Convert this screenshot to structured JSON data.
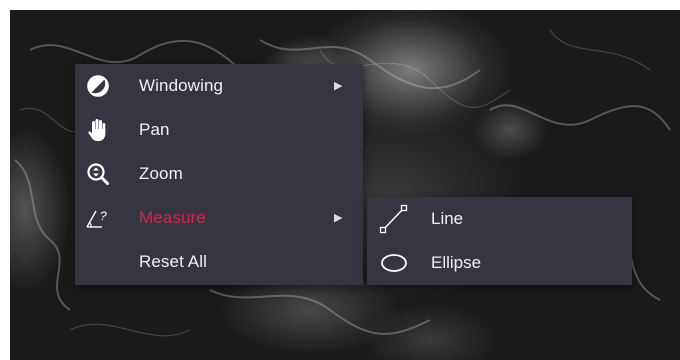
{
  "menu": {
    "items": [
      {
        "label": "Windowing",
        "icon": "contrast-icon",
        "has_submenu": true
      },
      {
        "label": "Pan",
        "icon": "hand-icon",
        "has_submenu": false
      },
      {
        "label": "Zoom",
        "icon": "zoom-icon",
        "has_submenu": false
      },
      {
        "label": "Measure",
        "icon": "measure-icon",
        "has_submenu": true,
        "active": true
      },
      {
        "label": "Reset All",
        "icon": "",
        "has_submenu": false
      }
    ],
    "arrow_glyph": "▶"
  },
  "submenu": {
    "items": [
      {
        "label": "Line",
        "icon": "line-tool-icon"
      },
      {
        "label": "Ellipse",
        "icon": "ellipse-tool-icon"
      }
    ]
  },
  "colors": {
    "menu_bg": "#363640",
    "text": "#f0f0f0",
    "active": "#d4244b"
  }
}
